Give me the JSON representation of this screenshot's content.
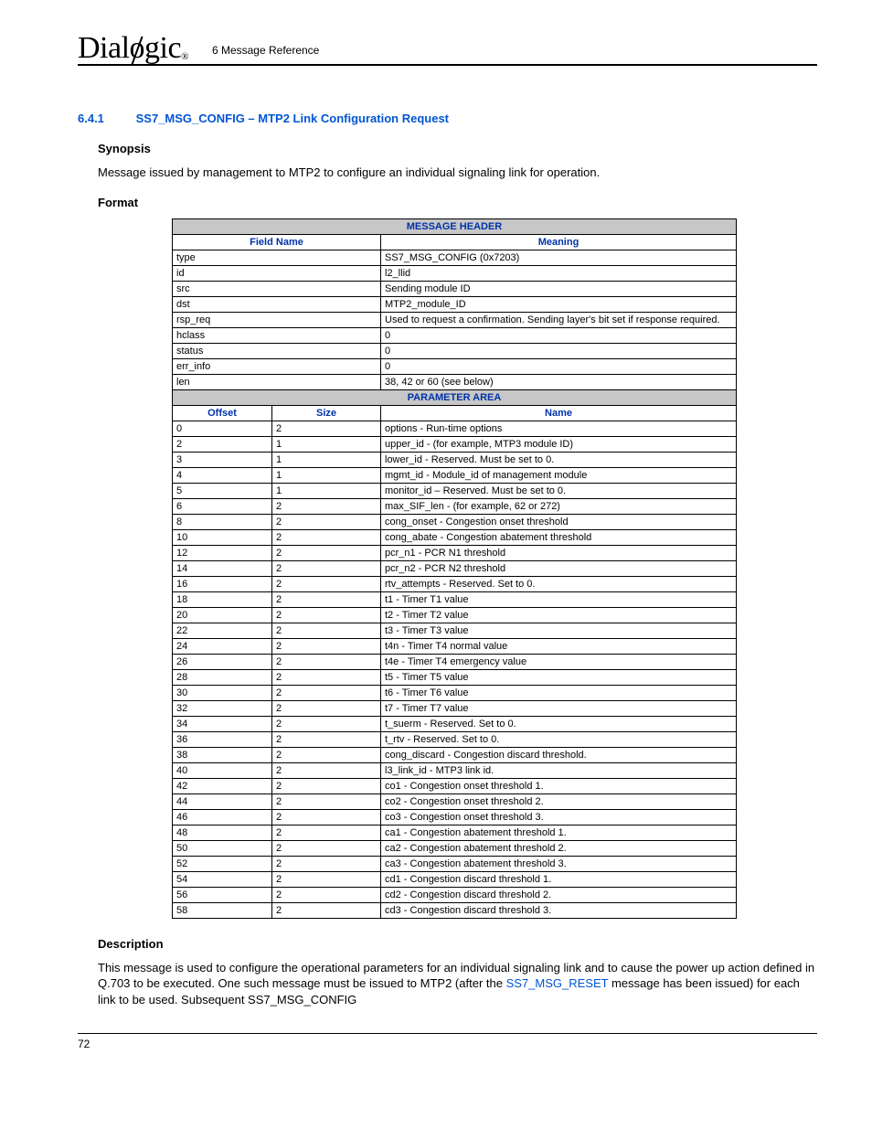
{
  "header": {
    "logo_text": "Dialogic",
    "chapter": "6 Message Reference"
  },
  "section": {
    "number": "6.4.1",
    "title": "SS7_MSG_CONFIG – MTP2 Link Configuration Request"
  },
  "synopsis": {
    "heading": "Synopsis",
    "text": "Message issued by management to MTP2 to configure an individual signaling link for operation."
  },
  "format_heading": "Format",
  "table": {
    "header_section": "MESSAGE HEADER",
    "field_name_hdr": "Field Name",
    "meaning_hdr": "Meaning",
    "header_rows": [
      {
        "field": "type",
        "meaning": "SS7_MSG_CONFIG (0x7203)"
      },
      {
        "field": "id",
        "meaning": "l2_llid"
      },
      {
        "field": "src",
        "meaning": "Sending module ID"
      },
      {
        "field": "dst",
        "meaning": "MTP2_module_ID"
      },
      {
        "field": "rsp_req",
        "meaning": "Used to request a confirmation. Sending layer's bit set if response required."
      },
      {
        "field": "hclass",
        "meaning": "0"
      },
      {
        "field": "status",
        "meaning": "0"
      },
      {
        "field": "err_info",
        "meaning": "0"
      },
      {
        "field": "len",
        "meaning": "38, 42 or 60 (see below)"
      }
    ],
    "param_section": "PARAMETER AREA",
    "offset_hdr": "Offset",
    "size_hdr": "Size",
    "name_hdr": "Name",
    "param_rows": [
      {
        "offset": "0",
        "size": "2",
        "name": "options - Run-time options"
      },
      {
        "offset": "2",
        "size": "1",
        "name": "upper_id - (for example, MTP3 module ID)"
      },
      {
        "offset": "3",
        "size": "1",
        "name": "lower_id - Reserved. Must be set to 0."
      },
      {
        "offset": "4",
        "size": "1",
        "name": "mgmt_id - Module_id of management module"
      },
      {
        "offset": "5",
        "size": "1",
        "name": "monitor_id – Reserved. Must be set to 0."
      },
      {
        "offset": "6",
        "size": "2",
        "name": "max_SIF_len - (for example, 62 or 272)"
      },
      {
        "offset": "8",
        "size": "2",
        "name": "cong_onset - Congestion onset threshold"
      },
      {
        "offset": "10",
        "size": "2",
        "name": "cong_abate - Congestion abatement threshold"
      },
      {
        "offset": "12",
        "size": "2",
        "name": "pcr_n1 - PCR N1 threshold"
      },
      {
        "offset": "14",
        "size": "2",
        "name": "pcr_n2 - PCR N2 threshold"
      },
      {
        "offset": "16",
        "size": "2",
        "name": "rtv_attempts - Reserved. Set to 0."
      },
      {
        "offset": "18",
        "size": "2",
        "name": "t1 - Timer T1 value"
      },
      {
        "offset": "20",
        "size": "2",
        "name": "t2 - Timer T2 value"
      },
      {
        "offset": "22",
        "size": "2",
        "name": "t3 - Timer T3 value"
      },
      {
        "offset": "24",
        "size": "2",
        "name": "t4n - Timer T4 normal value"
      },
      {
        "offset": "26",
        "size": "2",
        "name": "t4e - Timer T4 emergency value"
      },
      {
        "offset": "28",
        "size": "2",
        "name": "t5 - Timer T5 value"
      },
      {
        "offset": "30",
        "size": "2",
        "name": "t6 - Timer T6 value"
      },
      {
        "offset": "32",
        "size": "2",
        "name": "t7 - Timer T7 value"
      },
      {
        "offset": "34",
        "size": "2",
        "name": "t_suerm - Reserved. Set to 0."
      },
      {
        "offset": "36",
        "size": "2",
        "name": "t_rtv - Reserved. Set to 0."
      },
      {
        "offset": "38",
        "size": "2",
        "name": "cong_discard - Congestion discard threshold."
      },
      {
        "offset": "40",
        "size": "2",
        "name": "l3_link_id - MTP3 link id."
      },
      {
        "offset": "42",
        "size": "2",
        "name": "co1 - Congestion onset threshold 1."
      },
      {
        "offset": "44",
        "size": "2",
        "name": "co2 - Congestion onset threshold 2."
      },
      {
        "offset": "46",
        "size": "2",
        "name": "co3 - Congestion onset threshold 3."
      },
      {
        "offset": "48",
        "size": "2",
        "name": "ca1 - Congestion abatement threshold 1."
      },
      {
        "offset": "50",
        "size": "2",
        "name": "ca2 - Congestion abatement threshold 2."
      },
      {
        "offset": "52",
        "size": "2",
        "name": "ca3 - Congestion abatement threshold 3."
      },
      {
        "offset": "54",
        "size": "2",
        "name": "cd1 - Congestion discard threshold 1."
      },
      {
        "offset": "56",
        "size": "2",
        "name": "cd2 - Congestion discard threshold 2."
      },
      {
        "offset": "58",
        "size": "2",
        "name": "cd3 - Congestion discard threshold 3."
      }
    ]
  },
  "description": {
    "heading": "Description",
    "text_before_link": "This message is used to configure the operational parameters for an individual signaling link and to cause the power up action defined in Q.703 to be executed. One such message must be issued to MTP2 (after the ",
    "link_text": "SS7_MSG_RESET",
    "text_after_link": " message has been issued) for each link to be used. Subsequent SS7_MSG_CONFIG"
  },
  "page_number": "72"
}
